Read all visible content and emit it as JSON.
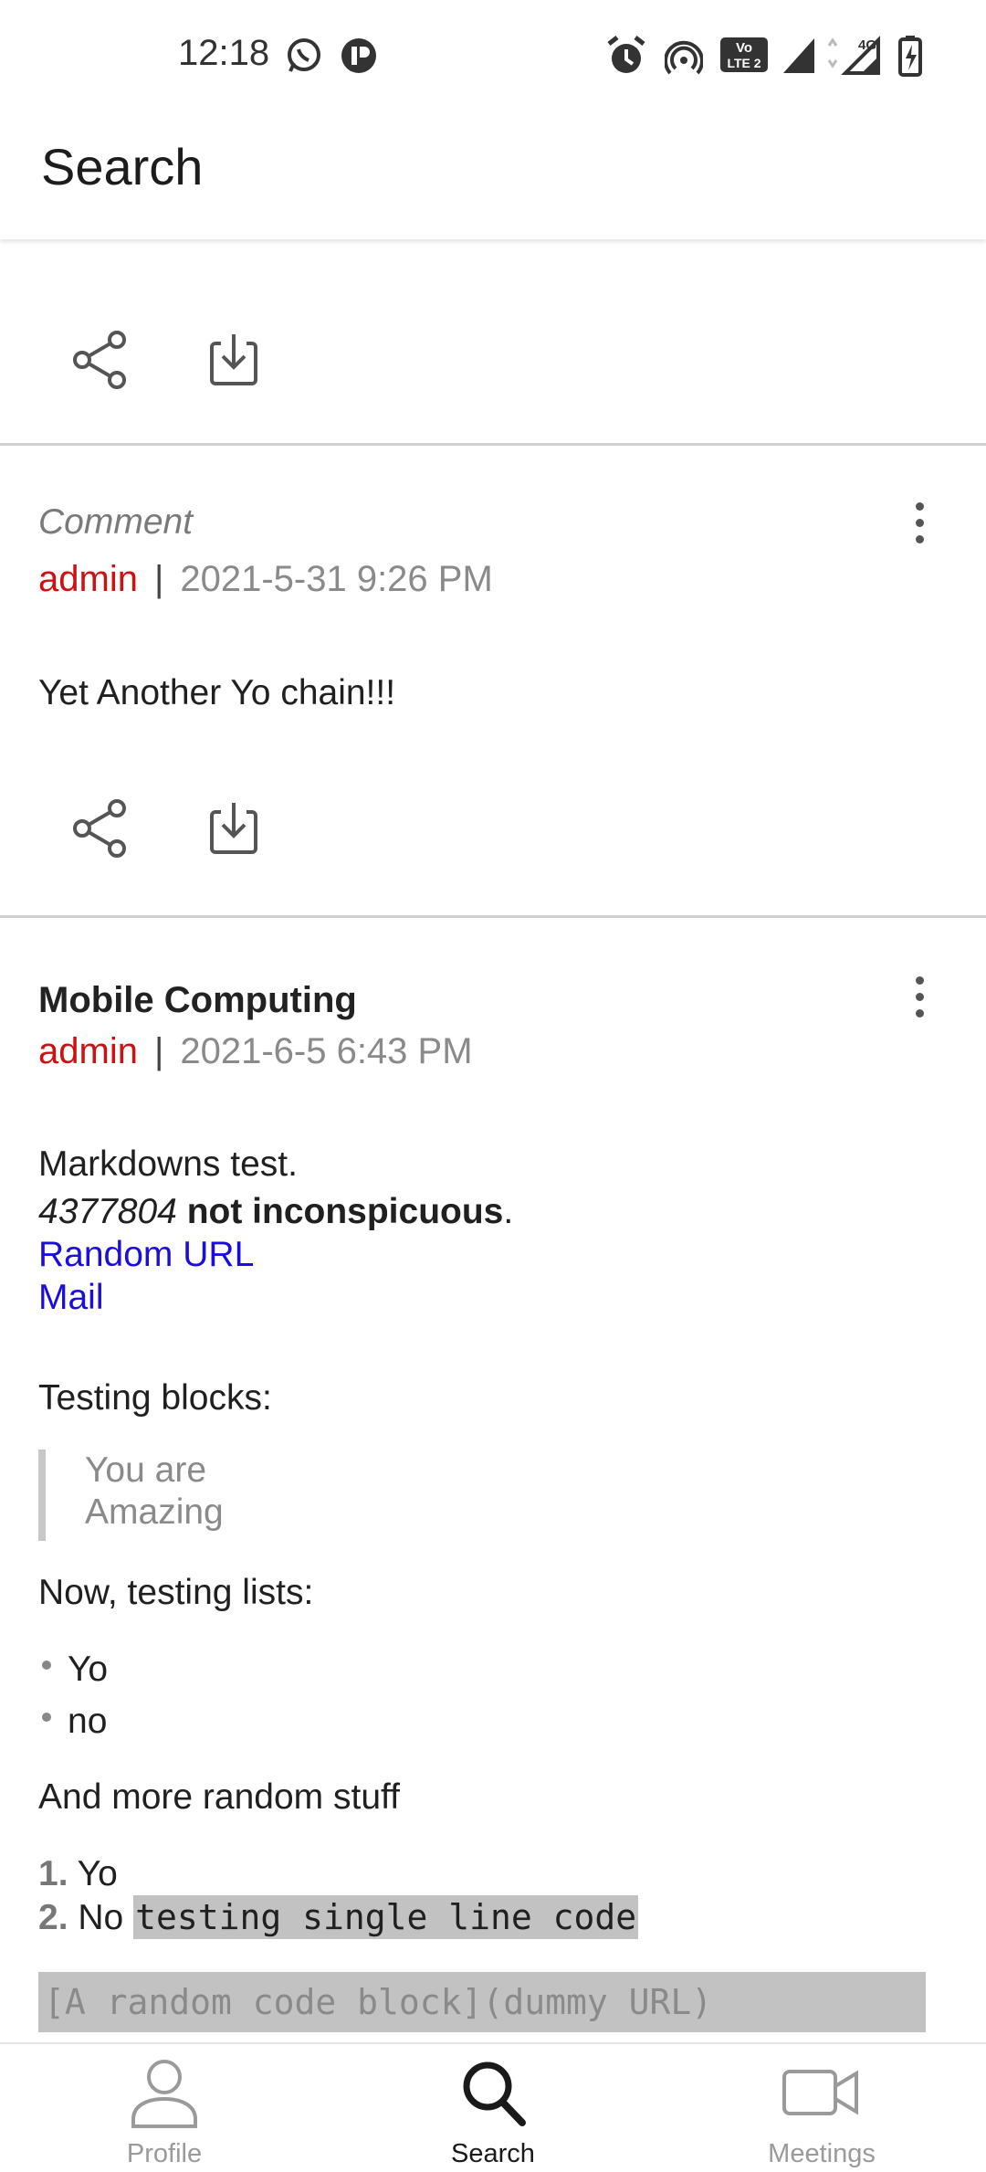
{
  "status_bar": {
    "time": "12:18",
    "left_icons": [
      "whatsapp-icon",
      "app-notification-icon"
    ],
    "right_icons": [
      "alarm-icon",
      "hotspot-icon",
      "volte-icon",
      "signal-icon",
      "4g-signal-icon",
      "battery-charging-icon"
    ],
    "volte_text": "VoLTE 2",
    "network_text": "4G"
  },
  "app_bar": {
    "title": "Search"
  },
  "posts": [
    {
      "actions": [
        "share-icon",
        "download-icon"
      ]
    },
    {
      "type_label": "Comment",
      "author": "admin",
      "separator": "|",
      "timestamp": "2021-5-31 9:26 PM",
      "body": "Yet Another Yo chain!!!"
    },
    {
      "title": "Mobile Computing",
      "author": "admin",
      "separator": "|",
      "timestamp": "2021-6-5 6:43 PM",
      "intro": "Markdowns test.",
      "italic_text": "4377804",
      "bold_text": "not inconspicuous",
      "period": ".",
      "link1": "Random URL",
      "link2": "Mail",
      "blocks_heading": "Testing blocks:",
      "quote_line1": "You are",
      "quote_line2": "Amazing",
      "lists_heading": "Now, testing lists:",
      "bullets": [
        "Yo",
        "no"
      ],
      "more_text": "And more random stuff",
      "ordered": [
        {
          "num": "1.",
          "text": "Yo"
        },
        {
          "num": "2.",
          "text": "No",
          "code": "testing single line code"
        }
      ],
      "code_block": "[A random code block](dummy URL)"
    }
  ],
  "bottom_nav": {
    "items": [
      {
        "label": "Profile",
        "icon": "person-icon",
        "active": false
      },
      {
        "label": "Search",
        "icon": "search-icon",
        "active": true
      },
      {
        "label": "Meetings",
        "icon": "video-camera-icon",
        "active": false
      }
    ]
  },
  "colors": {
    "author": "#d01010",
    "link": "#1a0dde",
    "nav_active": "#1a1a1a",
    "nav_inactive": "#9a9a9a",
    "code_bg": "#c2c2c2"
  }
}
